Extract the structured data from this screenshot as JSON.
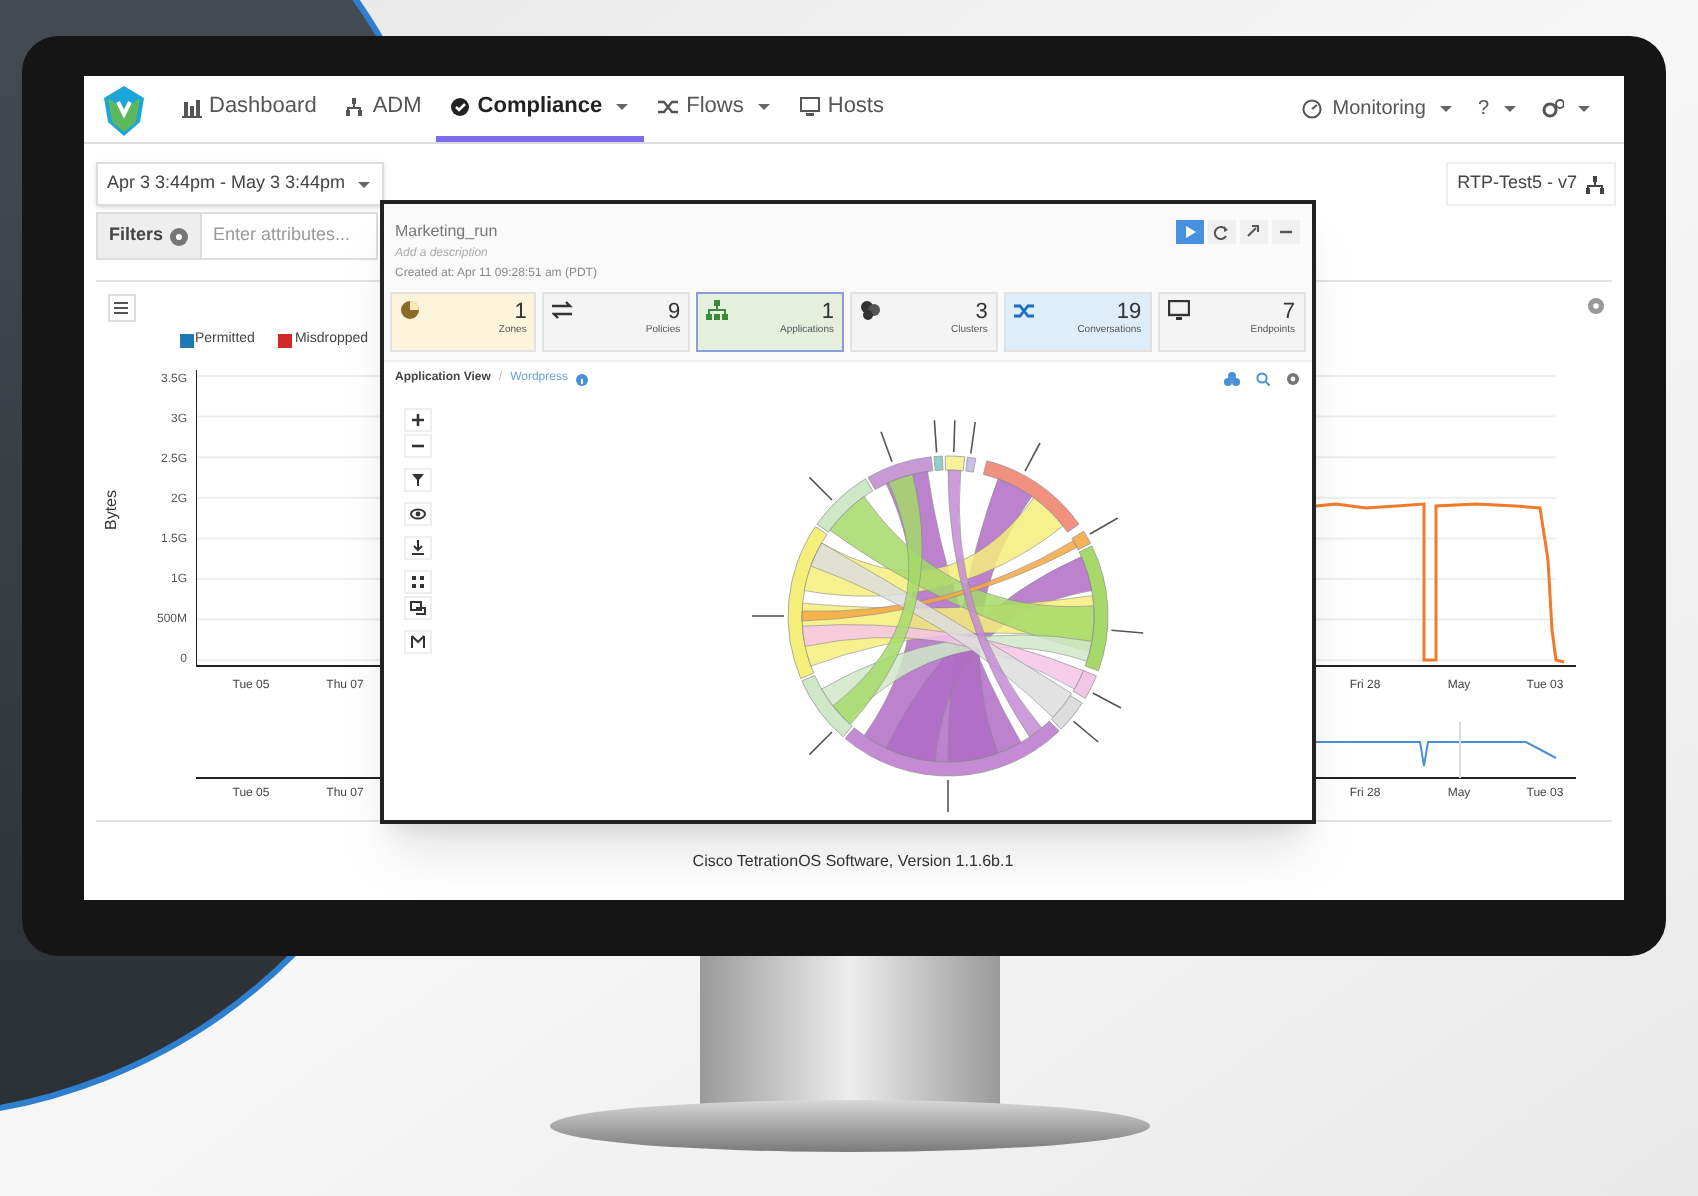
{
  "nav": {
    "items": [
      {
        "label": "Dashboard",
        "selected": false,
        "dropdown": false
      },
      {
        "label": "ADM",
        "selected": false,
        "dropdown": false
      },
      {
        "label": "Compliance",
        "selected": true,
        "dropdown": true
      },
      {
        "label": "Flows",
        "selected": false,
        "dropdown": true
      },
      {
        "label": "Hosts",
        "selected": false,
        "dropdown": false
      }
    ],
    "right": [
      {
        "label": "Monitoring"
      },
      {
        "label": "?"
      }
    ]
  },
  "date_range": "Apr 3 3:44pm - May 3 3:44pm",
  "scope": "RTP-Test5 - v7",
  "filters": {
    "label": "Filters",
    "placeholder": "Enter attributes..."
  },
  "traffic_chart": {
    "legend": [
      {
        "label": "Permitted",
        "color": "#1f77b4"
      },
      {
        "label": "Misdropped",
        "color": "#d62728"
      }
    ],
    "ylabel": "Bytes",
    "yticks": [
      "3.5G",
      "3G",
      "2.5G",
      "2G",
      "1.5G",
      "1G",
      "500M",
      "0"
    ],
    "xticks": [
      "Tue 05",
      "Thu 07",
      "Fri 28",
      "May",
      "Tue 03"
    ],
    "overview_xticks": [
      "Tue 05",
      "Thu 07",
      "Fri 28",
      "May",
      "Tue 03"
    ]
  },
  "workspace": {
    "title": "Marketing_run",
    "description_placeholder": "Add a description",
    "created": "Created at: Apr 11 09:28:51 am (PDT)",
    "actions": [
      {
        "selected": true
      },
      {
        "selected": false
      },
      {
        "selected": false
      },
      {
        "selected": false
      }
    ],
    "stats": [
      {
        "count": "1",
        "label": "Zones",
        "color": "#fcf5dc",
        "selected": false
      },
      {
        "count": "9",
        "label": "Policies",
        "color": "#f4f4f4",
        "selected": false
      },
      {
        "count": "1",
        "label": "Applications",
        "color": "#e4f0dc",
        "selected": true
      },
      {
        "count": "3",
        "label": "Clusters",
        "color": "#f4f4f4",
        "selected": false
      },
      {
        "count": "19",
        "label": "Conversations",
        "color": "#ddedf9",
        "selected": false
      },
      {
        "count": "7",
        "label": "Endpoints",
        "color": "#f4f4f4",
        "selected": false
      }
    ],
    "breadcrumb": [
      "Application View",
      "/",
      "Wordpress"
    ]
  },
  "footer": "Cisco TetrationOS Software, Version 1.1.6b.1"
}
